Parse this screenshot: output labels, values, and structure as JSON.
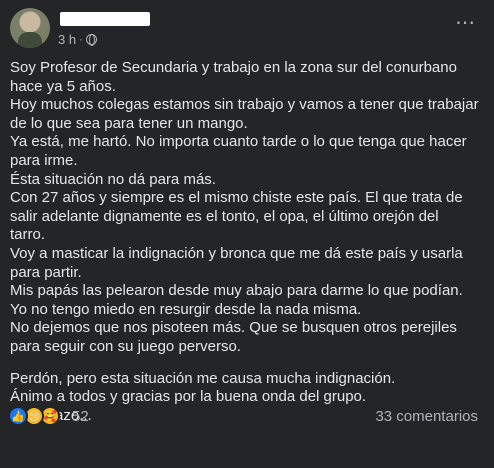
{
  "post": {
    "time": "3 h",
    "separator": "·",
    "more_icon": "⋯",
    "body_lines": [
      "Soy Profesor de Secundaria y trabajo en la zona sur del conurbano",
      "hace ya 5 años.",
      "Hoy muchos colegas estamos sin trabajo y vamos a tener que trabajar",
      "de lo que sea para tener un mango.",
      "Ya está, me hartó. No importa cuanto tarde o lo que tenga que hacer",
      "para irme.",
      "Ésta situación no dá para más.",
      "Con 27 años y siempre es el mismo chiste este país. El que trata de",
      "salir adelante dignamente es el tonto, el opa, el último orejón del",
      "tarro.",
      "Voy a masticar la indignación y bronca que me dá este país y usarla",
      "para partir.",
      "Mis papás las pelearon desde muy abajo para darme lo que podían.",
      "Yo no tengo miedo en resurgir desde la nada misma.",
      "No dejemos que nos pisoteen más. Que se busquen otros perejiles",
      "para seguir con su juego perverso."
    ],
    "closing_lines": [
      "Perdón, pero esta situación me causa mucha indignación.",
      "Ánimo a todos y gracias por la buena onda del grupo.",
      "Un abrazo..."
    ],
    "reactions": {
      "count": "52",
      "icons": [
        "like-icon",
        "sad-icon",
        "care-icon"
      ],
      "like_glyph": "👍",
      "sad_glyph": "😢",
      "care_glyph": "🥰"
    },
    "comments_label": "33 comentarios"
  }
}
